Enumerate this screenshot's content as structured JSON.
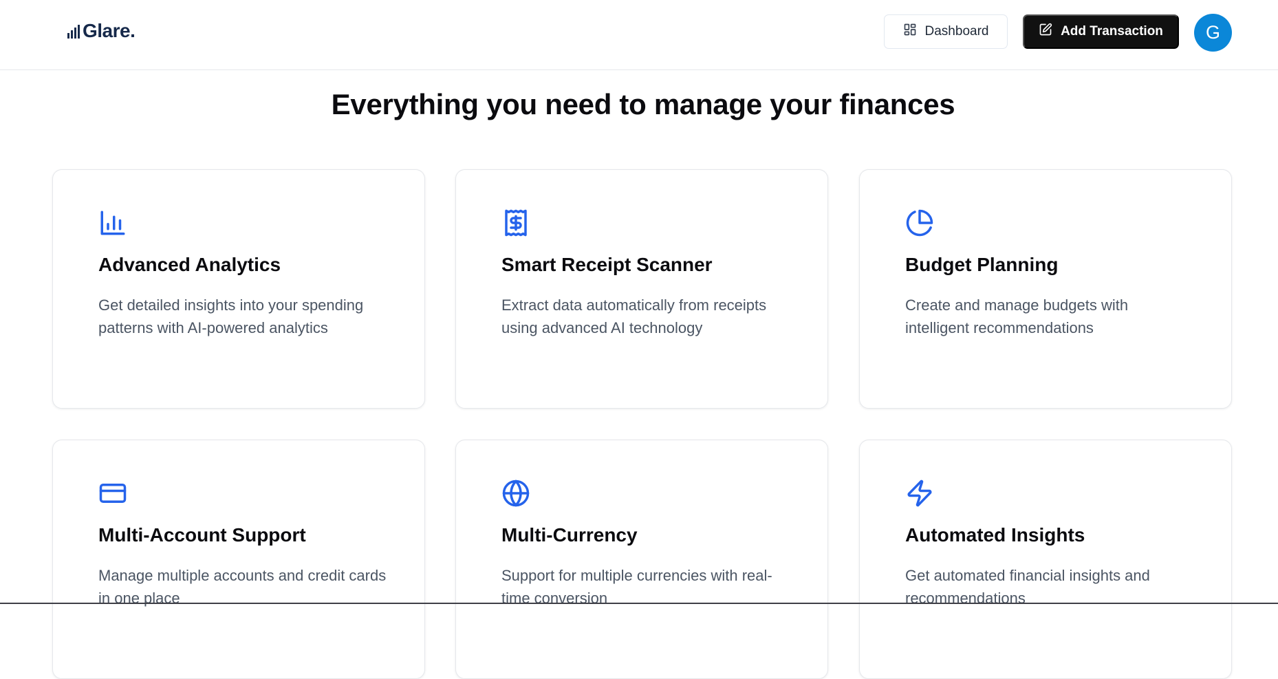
{
  "header": {
    "logo_text": "Glare.",
    "dashboard_label": "Dashboard",
    "add_transaction_label": "Add Transaction",
    "avatar_initial": "G"
  },
  "colors": {
    "accent": "#2563eb",
    "avatar": "#0b87d8",
    "primary_button": "#111111",
    "logo": "#16294a"
  },
  "section": {
    "title": "Everything you need to manage your finances"
  },
  "features": [
    {
      "icon": "bar-chart-icon",
      "title": "Advanced Analytics",
      "description": "Get detailed insights into your spending patterns with AI-powered analytics"
    },
    {
      "icon": "receipt-icon",
      "title": "Smart Receipt Scanner",
      "description": "Extract data automatically from receipts using advanced AI technology"
    },
    {
      "icon": "pie-chart-icon",
      "title": "Budget Planning",
      "description": "Create and manage budgets with intelligent recommendations"
    },
    {
      "icon": "credit-card-icon",
      "title": "Multi-Account Support",
      "description": "Manage multiple accounts and credit cards in one place"
    },
    {
      "icon": "globe-icon",
      "title": "Multi-Currency",
      "description": "Support for multiple currencies with real-time conversion"
    },
    {
      "icon": "lightning-icon",
      "title": "Automated Insights",
      "description": "Get automated financial insights and recommendations"
    }
  ]
}
